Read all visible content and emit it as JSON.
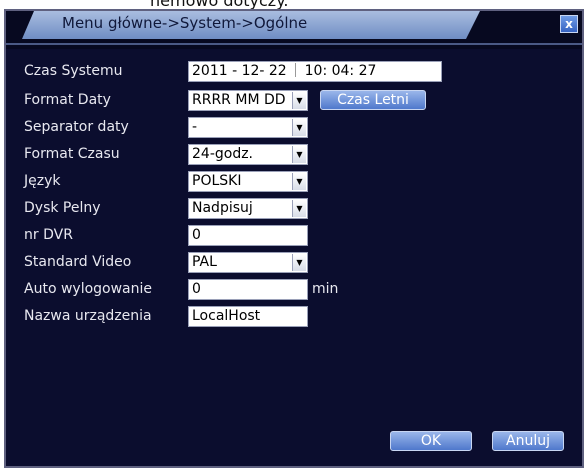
{
  "top_caption": "nemowo dotyczy.",
  "window": {
    "title": "Menu główne->System->Ogólne",
    "close_symbol": "x"
  },
  "fields": {
    "system_time": {
      "label": "Czas Systemu",
      "date": "2011 - 12- 22",
      "time": "10: 04: 27"
    },
    "date_format": {
      "label": "Format Daty",
      "value": "RRRR MM DD",
      "dst_button": "Czas Letni"
    },
    "date_separator": {
      "label": "Separator daty",
      "value": "-"
    },
    "time_format": {
      "label": "Format Czasu",
      "value": "24-godz."
    },
    "language": {
      "label": "Język",
      "value": "POLSKI"
    },
    "disk_full": {
      "label": "Dysk Pelny",
      "value": "Nadpisuj"
    },
    "dvr_no": {
      "label": "nr DVR",
      "value": "0"
    },
    "video_standard": {
      "label": "Standard Video",
      "value": "PAL"
    },
    "auto_logout": {
      "label": "Auto wylogowanie",
      "value": "0",
      "unit": "min"
    },
    "device_name": {
      "label": "Nazwa urządzenia",
      "value": "LocalHost"
    }
  },
  "buttons": {
    "ok": "OK",
    "cancel": "Anuluj"
  },
  "icons": {
    "dropdown": "chevron-down-icon",
    "close": "close-icon"
  },
  "colors": {
    "background": "#0b0d2e",
    "title_tab": "#8ea6d6",
    "button": "#5f86d6"
  }
}
